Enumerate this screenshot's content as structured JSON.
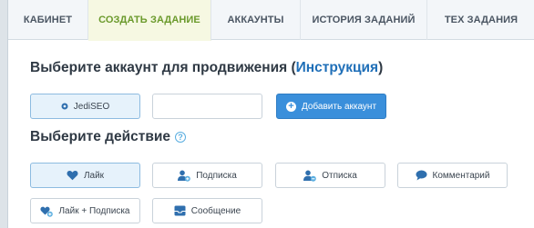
{
  "tabs": [
    {
      "label": "КАБИНЕТ"
    },
    {
      "label": "СОЗДАТЬ ЗАДАНИЕ"
    },
    {
      "label": "АККАУНТЫ"
    },
    {
      "label": "ИСТОРИЯ ЗАДАНИЙ"
    },
    {
      "label": "ТЕХ ЗАДАНИЯ"
    }
  ],
  "account_section": {
    "title": "Выберите аккаунт для продвижения (",
    "link": "Инструкция",
    "title_end": ")",
    "account_label": "JediSEO",
    "input_value": "",
    "add_label": "Добавить аккаунт"
  },
  "action_section": {
    "title": "Выберите действие",
    "help": "?",
    "actions": [
      {
        "label": "Лайк",
        "icon": "heart-icon"
      },
      {
        "label": "Подписка",
        "icon": "user-add-icon"
      },
      {
        "label": "Отписка",
        "icon": "user-remove-icon"
      },
      {
        "label": "Комментарий",
        "icon": "comment-icon"
      },
      {
        "label": "Лайк + Подписка",
        "icon": "heart-user-icon"
      },
      {
        "label": "Сообщение",
        "icon": "inbox-icon"
      }
    ]
  },
  "colors": {
    "accent": "#3a8fdb",
    "active_tab": "#6b9a2c",
    "link": "#1f6fb8",
    "icon": "#2f6fae"
  }
}
